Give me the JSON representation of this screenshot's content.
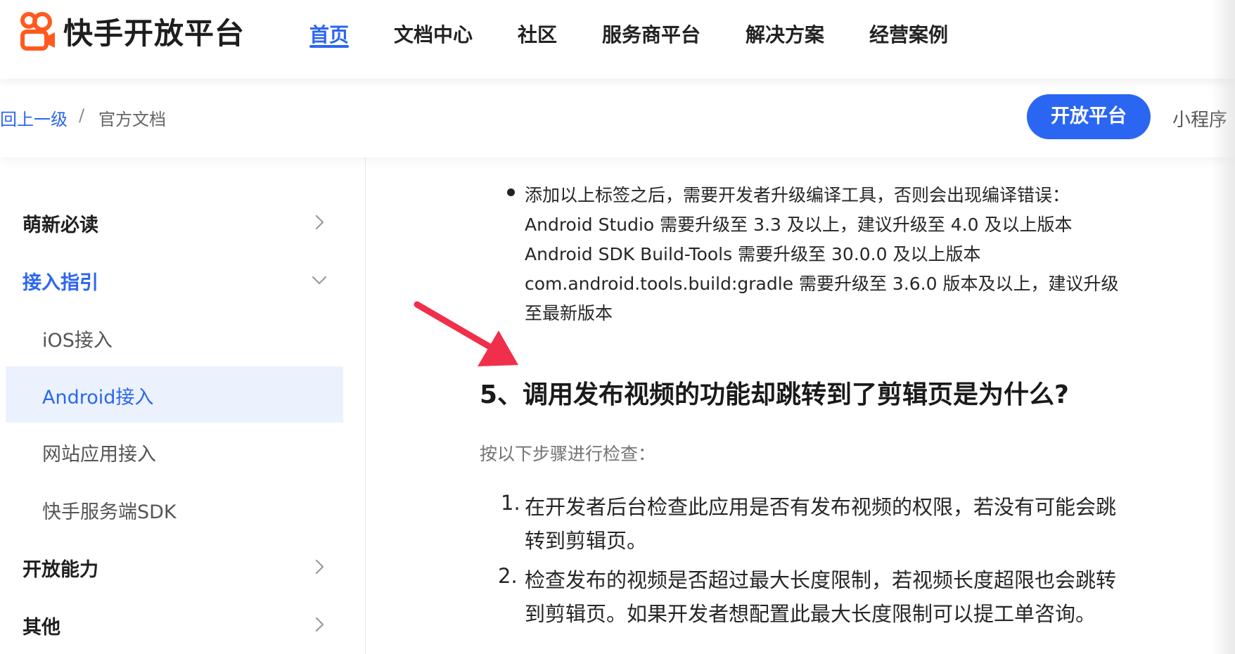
{
  "brand": {
    "name": "快手开放平台",
    "accent": "#2b66f2",
    "logo_color": "#ff5a1f"
  },
  "nav": {
    "items": [
      {
        "label": "首页",
        "active": true
      },
      {
        "label": "文档中心"
      },
      {
        "label": "社区"
      },
      {
        "label": "服务商平台"
      },
      {
        "label": "解决方案"
      },
      {
        "label": "经营案例"
      }
    ]
  },
  "breadcrumb": {
    "back": "回上一级",
    "separator": "/",
    "current": "官方文档"
  },
  "subbar": {
    "primary_pill": "开放平台",
    "secondary_tab": "小程序"
  },
  "sidebar": {
    "items": [
      {
        "label": "萌新必读",
        "level": "top",
        "icon": "chevron-right-icon"
      },
      {
        "label": "接入指引",
        "level": "top",
        "expanded": true,
        "icon": "chevron-down-icon"
      },
      {
        "label": "iOS接入",
        "level": "sub"
      },
      {
        "label": "Android接入",
        "level": "sub",
        "selected": true
      },
      {
        "label": "网站应用接入",
        "level": "sub"
      },
      {
        "label": "快手服务端SDK",
        "level": "sub"
      },
      {
        "label": "开放能力",
        "level": "top",
        "icon": "chevron-right-icon"
      },
      {
        "label": "其他",
        "level": "top",
        "icon": "chevron-right-icon"
      }
    ]
  },
  "content": {
    "bullet_lines": [
      "添加以上标签之后，需要开发者升级编译工具，否则会出现编译错误：",
      "Android Studio 需要升级至 3.3 及以上，建议升级至 4.0 及以上版本",
      "Android SDK Build-Tools 需要升级至 30.0.0 及以上版本",
      "com.android.tools.build:gradle 需要升级至 3.6.0 版本及以上，建议升级",
      "至最新版本"
    ],
    "heading": "5、调用发布视频的功能却跳转到了剪辑页是为什么?",
    "intro": "按以下步骤进行检查：",
    "steps": [
      {
        "num": "1.",
        "lines": [
          "在开发者后台检查此应用是否有发布视频的权限，若没有可能会跳",
          "转到剪辑页。"
        ]
      },
      {
        "num": "2.",
        "lines": [
          "检查发布的视频是否超过最大长度限制，若视频长度超限也会跳转",
          "到剪辑页。如果开发者想配置此最大长度限制可以提工单咨询。"
        ]
      }
    ]
  },
  "annotation": {
    "arrow_color": "#f0304a"
  }
}
